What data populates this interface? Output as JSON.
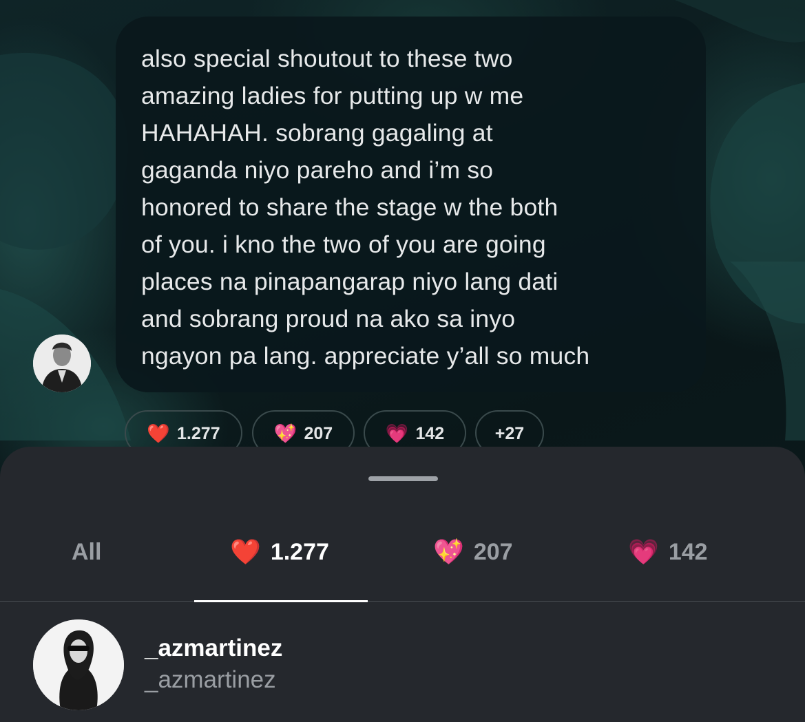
{
  "message": {
    "text": "also special shoutout to these two\namazing ladies for putting up w me\nHAHAHAH. sobrang gagaling at\ngaganda niyo pareho and i’m so\nhonored to share the stage w the both\nof you. i kno the two of you are going\nplaces na pinapangarap niyo lang dati\nand sobrang proud na ako sa inyo\nngayon pa lang. appreciate y’all so much"
  },
  "reaction_pills": [
    {
      "emoji": "❤️",
      "count": "1.277"
    },
    {
      "emoji": "💖",
      "count": "207"
    },
    {
      "emoji": "💗",
      "count": "142"
    },
    {
      "emoji": "",
      "count": "+27"
    }
  ],
  "sheet": {
    "tabs": [
      {
        "label": "All",
        "emoji": ""
      },
      {
        "label": "1.277",
        "emoji": "❤️"
      },
      {
        "label": "207",
        "emoji": "💖"
      },
      {
        "label": "142",
        "emoji": "💗"
      }
    ],
    "active_tab": 1
  },
  "user": {
    "display_name": "_azmartinez",
    "handle": "_azmartinez"
  },
  "colors": {
    "sheet_bg": "#25282d",
    "bubble_bg": "#0a181c",
    "active_tab": "#ffffff",
    "inactive_tab": "#9a9ea3"
  }
}
